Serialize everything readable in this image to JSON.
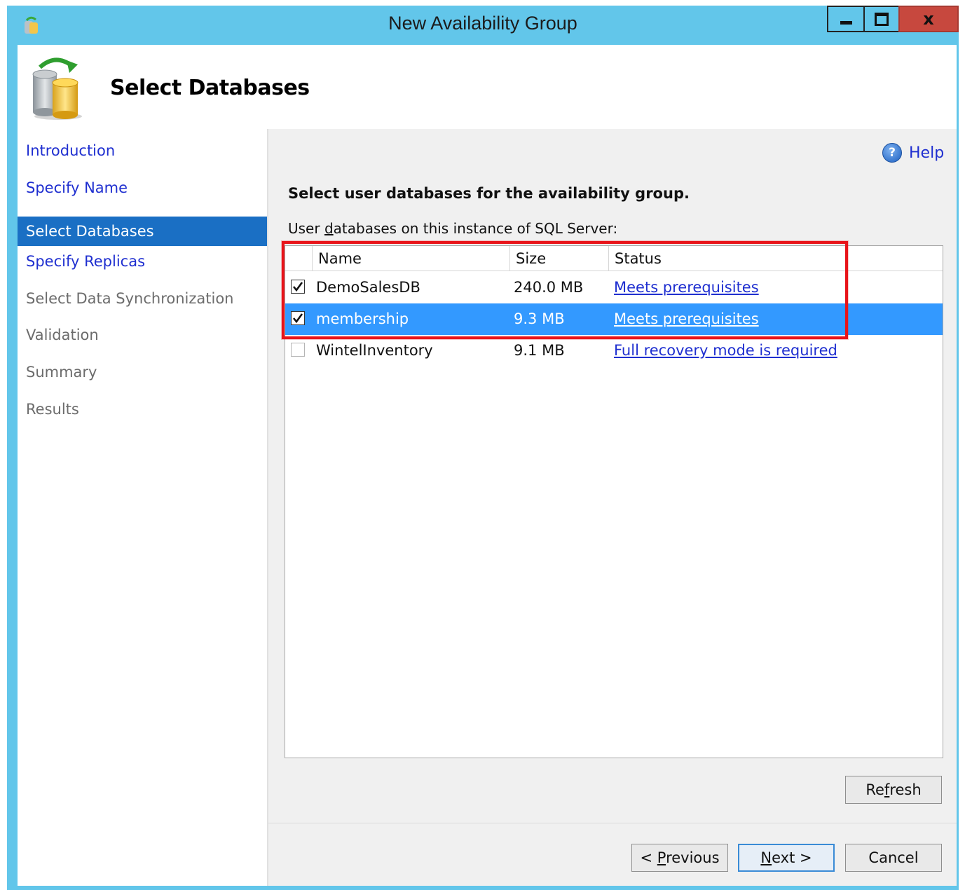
{
  "window": {
    "title": "New Availability Group",
    "minimize_icon": "minimize-icon",
    "maximize_icon": "maximize-icon",
    "close_icon": "close-icon",
    "close_glyph": "x"
  },
  "header": {
    "title": "Select Databases",
    "icon": "database-sync-icon"
  },
  "nav": {
    "items": [
      {
        "label": "Introduction",
        "state": "link"
      },
      {
        "label": "Specify Name",
        "state": "link"
      },
      {
        "label": "Select Databases",
        "state": "active"
      },
      {
        "label": "Specify Replicas",
        "state": "link"
      },
      {
        "label": "Select Data Synchronization",
        "state": "disabled"
      },
      {
        "label": "Validation",
        "state": "disabled"
      },
      {
        "label": "Summary",
        "state": "disabled"
      },
      {
        "label": "Results",
        "state": "disabled"
      }
    ]
  },
  "content": {
    "help_label": "Help",
    "help_icon": "help-icon",
    "instruction": "Select user databases for the availability group.",
    "list_label_pre": "User ",
    "list_label_accel": "d",
    "list_label_post": "atabases on this instance of SQL Server:",
    "columns": {
      "name": "Name",
      "size": "Size",
      "status": "Status"
    },
    "rows": [
      {
        "checked": true,
        "name": "DemoSalesDB",
        "size": "240.0 MB",
        "status": "Meets prerequisites",
        "selected": false
      },
      {
        "checked": true,
        "name": "membership",
        "size": "9.3 MB",
        "status": "Meets prerequisites",
        "selected": true
      },
      {
        "checked": false,
        "name": "WintelInventory",
        "size": "9.1 MB",
        "status": "Full recovery mode is required",
        "selected": false
      }
    ],
    "refresh_pre": "Re",
    "refresh_accel": "f",
    "refresh_post": "resh"
  },
  "footer": {
    "previous_pre": "< ",
    "previous_accel": "P",
    "previous_post": "revious",
    "next_accel": "N",
    "next_post": "ext >",
    "cancel": "Cancel"
  },
  "colors": {
    "titlebar": "#62c6ea",
    "close_button": "#c7483e",
    "nav_active": "#1a6fc4",
    "row_selected": "#3399ff",
    "link": "#1f2fd0",
    "highlight_box": "#e8141a"
  }
}
